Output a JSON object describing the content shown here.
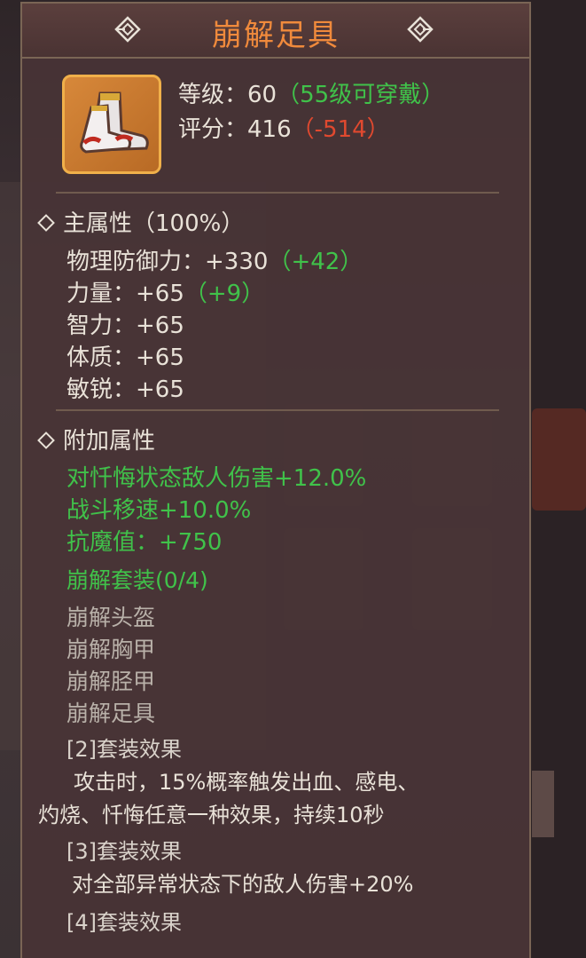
{
  "tooltip": {
    "title": "崩解足具",
    "icon": "boots-icon",
    "level_label": "等级：",
    "level_value": "60",
    "level_req": "（55级可穿戴）",
    "score_label": "评分：",
    "score_value": "416",
    "score_diff": "（-514）",
    "main_attr_title": "主属性（100%）",
    "main_attrs": [
      {
        "name": "物理防御力：",
        "value": "+330",
        "bonus": "（+42）"
      },
      {
        "name": "力量：",
        "value": "+65",
        "bonus": "（+9）"
      },
      {
        "name": "智力：",
        "value": "+65",
        "bonus": ""
      },
      {
        "name": "体质：",
        "value": "+65",
        "bonus": ""
      },
      {
        "name": "敏锐：",
        "value": "+65",
        "bonus": ""
      }
    ],
    "extra_attr_title": "附加属性",
    "extra_attrs": [
      "对忏悔状态敌人伤害+12.0%",
      "战斗移速+10.0%",
      "抗魔值：+750"
    ],
    "set_name": "崩解套装(0/4)",
    "set_pieces": [
      "崩解头盔",
      "崩解胸甲",
      "崩解胫甲",
      "崩解足具"
    ],
    "set_effects": [
      {
        "title": "[2]套装效果",
        "lines": [
          "攻击时，15%概率触发出血、感电、",
          "灼烧、忏悔任意一种效果，持续10秒"
        ]
      },
      {
        "title": "[3]套装效果",
        "lines": [
          "对全部异常状态下的敌人伤害+20%"
        ]
      },
      {
        "title": "[4]套装效果",
        "lines": []
      }
    ]
  },
  "colors": {
    "title": "#f08a3c",
    "green": "#40c24a",
    "red": "#e0492f",
    "text": "#e9e2d8"
  }
}
